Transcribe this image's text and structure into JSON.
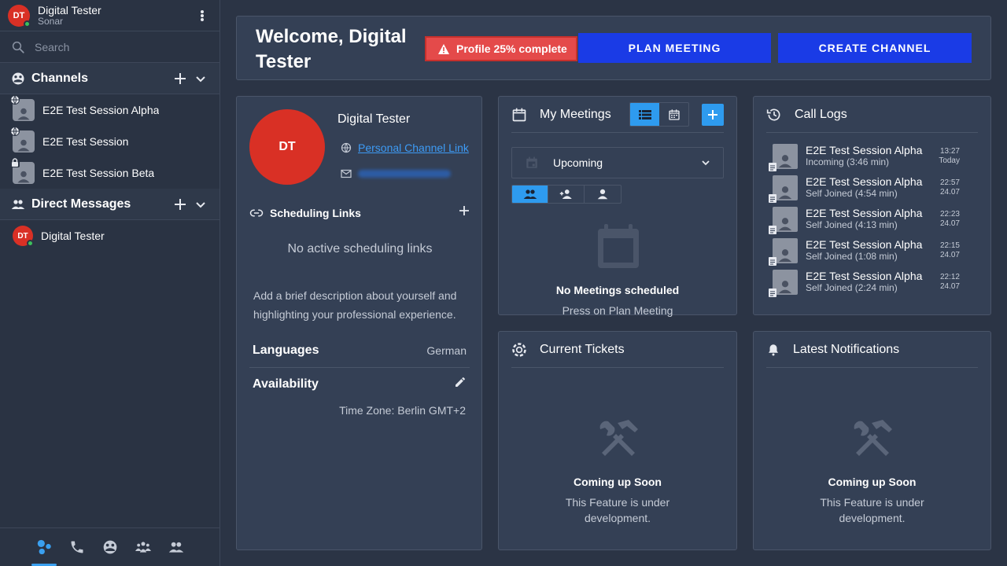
{
  "sidebar": {
    "user": {
      "initials": "DT",
      "name": "Digital Tester",
      "subtitle": "Sonar"
    },
    "search": {
      "placeholder": "Search"
    },
    "channels": {
      "title": "Channels",
      "items": [
        {
          "label": "E2E Test Session Alpha",
          "badge": "globe-icon"
        },
        {
          "label": "E2E Test Session",
          "badge": "globe-icon"
        },
        {
          "label": "E2E Test Session Beta",
          "badge": "lock-icon"
        }
      ]
    },
    "direct_messages": {
      "title": "Direct Messages",
      "items": [
        {
          "initials": "DT",
          "label": "Digital Tester"
        }
      ]
    },
    "bottom_nav": [
      "chats-icon",
      "phone-icon",
      "channels-icon",
      "groups-icon",
      "contacts-icon"
    ]
  },
  "welcome": {
    "title": "Welcome, Digital Tester",
    "profile_warning": "Profile 25% complete",
    "plan_meeting": "PLAN MEETING",
    "create_channel": "CREATE CHANNEL"
  },
  "profile": {
    "initials": "DT",
    "name": "Digital Tester",
    "channel_link": "Personal Channel Link",
    "scheduling_title": "Scheduling Links",
    "no_links": "No active scheduling links",
    "description": "Add a brief description about yourself and highlighting your professional experience.",
    "languages_label": "Languages",
    "languages_value": "German",
    "availability_label": "Availability",
    "timezone": "Time Zone: Berlin GMT+2"
  },
  "meetings": {
    "title": "My Meetings",
    "filter": "Upcoming",
    "empty_title": "No Meetings scheduled",
    "empty_sub": "Press on Plan Meeting"
  },
  "call_logs": {
    "title": "Call Logs",
    "items": [
      {
        "name": "E2E Test Session Alpha",
        "detail": "Incoming (3:46 min)",
        "time": "13:27",
        "date": "Today"
      },
      {
        "name": "E2E Test Session Alpha",
        "detail": "Self Joined (4:54 min)",
        "time": "22:57",
        "date": "24.07"
      },
      {
        "name": "E2E Test Session Alpha",
        "detail": "Self Joined (4:13 min)",
        "time": "22:23",
        "date": "24.07"
      },
      {
        "name": "E2E Test Session Alpha",
        "detail": "Self Joined (1:08 min)",
        "time": "22:15",
        "date": "24.07"
      },
      {
        "name": "E2E Test Session Alpha",
        "detail": "Self Joined (2:24 min)",
        "time": "22:12",
        "date": "24.07"
      }
    ]
  },
  "tickets": {
    "title": "Current Tickets",
    "empty_title": "Coming up Soon",
    "empty_sub": "This Feature is under development."
  },
  "notifications": {
    "title": "Latest Notifications",
    "empty_title": "Coming up Soon",
    "empty_sub": "This Feature is under development."
  },
  "colors": {
    "accent": "#2e9bef",
    "primary_button": "#1a3be6",
    "warning": "#e44a4a",
    "avatar": "#d93025",
    "online": "#3cc05c"
  }
}
